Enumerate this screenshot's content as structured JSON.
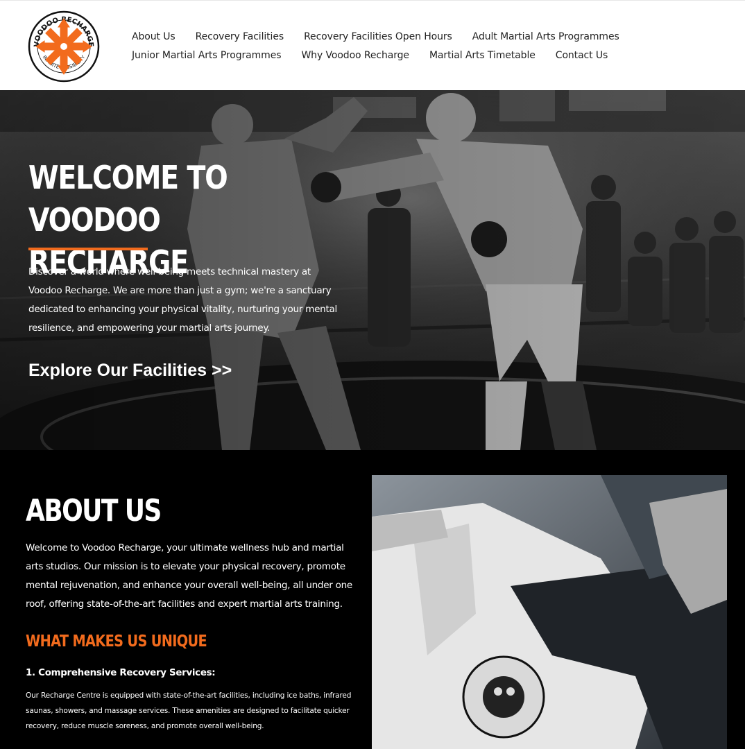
{
  "brand": {
    "logo_text_top": "VOODOO RECHARGE",
    "logo_text_bottom": "INFINITE POSSIBILITY",
    "accent_color": "#f26b1d"
  },
  "nav": {
    "row1": [
      "About Us",
      "Recovery Facilities",
      "Recovery Facilities Open Hours",
      "Adult Martial Arts Programmes"
    ],
    "row2": [
      "Junior Martial Arts Programmes",
      "Why Voodoo Recharge",
      "Martial Arts Timetable",
      "Contact Us"
    ]
  },
  "hero": {
    "title_line1": "Welcome to Voodoo",
    "title_line2": "Recharge",
    "text": "Discover a world where well-being meets technical mastery at Voodoo Recharge. We are more than just a gym; we're a sanctuary dedicated to enhancing your physical vitality, nurturing your mental resilience, and empowering your martial arts journey.",
    "cta": "Explore Our Facilities >>"
  },
  "about": {
    "title": "About Us",
    "text": "Welcome to Voodoo Recharge, your ultimate wellness hub and martial arts studios. Our mission is to elevate your physical recovery, promote mental rejuvenation, and enhance your overall well-being, all under one roof, offering state-of-the-art facilities and expert martial arts training.",
    "unique_title": "What Makes Us Unique",
    "point1_title": "1. Comprehensive Recovery Services:",
    "point1_text": "Our Recharge Centre is equipped with state-of-the-art facilities, including ice baths, infrared saunas, showers, and massage services. These amenities are designed to facilitate quicker recovery, reduce muscle soreness, and promote overall well-being."
  }
}
